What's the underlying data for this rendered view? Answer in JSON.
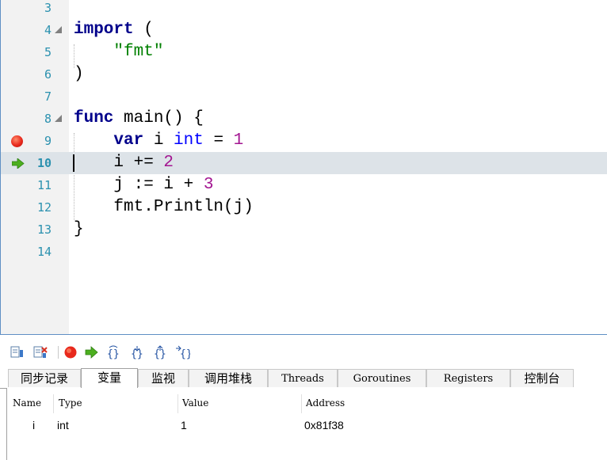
{
  "editor": {
    "lines": [
      {
        "number": "3"
      },
      {
        "number": "4",
        "fold": true,
        "tokens": [
          {
            "t": "import",
            "c": "kw"
          },
          {
            "t": " (",
            "c": ""
          }
        ]
      },
      {
        "number": "5",
        "tokens": [
          {
            "t": "    ",
            "c": ""
          },
          {
            "t": "\"fmt\"",
            "c": "str"
          }
        ]
      },
      {
        "number": "6",
        "tokens": [
          {
            "t": ")",
            "c": ""
          }
        ]
      },
      {
        "number": "7"
      },
      {
        "number": "8",
        "fold": true,
        "tokens": [
          {
            "t": "func",
            "c": "kw"
          },
          {
            "t": " main() {",
            "c": ""
          }
        ]
      },
      {
        "number": "9",
        "breakpoint": true,
        "tokens": [
          {
            "t": "    ",
            "c": ""
          },
          {
            "t": "var",
            "c": "kw"
          },
          {
            "t": " i ",
            "c": ""
          },
          {
            "t": "int",
            "c": "typ"
          },
          {
            "t": " = ",
            "c": ""
          },
          {
            "t": "1",
            "c": "num"
          }
        ]
      },
      {
        "number": "10",
        "current": true,
        "tokens": [
          {
            "t": "    i += ",
            "c": ""
          },
          {
            "t": "2",
            "c": "num"
          }
        ]
      },
      {
        "number": "11",
        "tokens": [
          {
            "t": "    j := i + ",
            "c": ""
          },
          {
            "t": "3",
            "c": "num"
          }
        ]
      },
      {
        "number": "12",
        "tokens": [
          {
            "t": "    fmt.Println(j)",
            "c": ""
          }
        ]
      },
      {
        "number": "13",
        "tokens": [
          {
            "t": "}",
            "c": ""
          }
        ]
      },
      {
        "number": "14"
      }
    ]
  },
  "toolbar": {
    "icons": [
      "log-icon",
      "clear-log-icon",
      "stop-icon",
      "continue-icon",
      "step-over-icon",
      "step-into-icon",
      "step-out-icon",
      "run-to-cursor-icon"
    ]
  },
  "tabs": [
    {
      "label": "同步记录"
    },
    {
      "label": "变量",
      "active": true
    },
    {
      "label": "监视"
    },
    {
      "label": "调用堆栈"
    },
    {
      "label": "Threads"
    },
    {
      "label": "Goroutines"
    },
    {
      "label": "Registers"
    },
    {
      "label": "控制台"
    }
  ],
  "variables": {
    "columns": [
      "Name",
      "Type",
      "Value",
      "Address"
    ],
    "rows": [
      {
        "name": "i",
        "type": "int",
        "value": "1",
        "address": "0x81f38"
      }
    ]
  },
  "colors": {
    "keyword": "#00008b",
    "type": "#0000ff",
    "string": "#008000",
    "number": "#a31591",
    "line_number": "#2b91af",
    "current_line": "#dde3e8",
    "breakpoint": "#e8291c",
    "arrow": "#4caf1f"
  }
}
